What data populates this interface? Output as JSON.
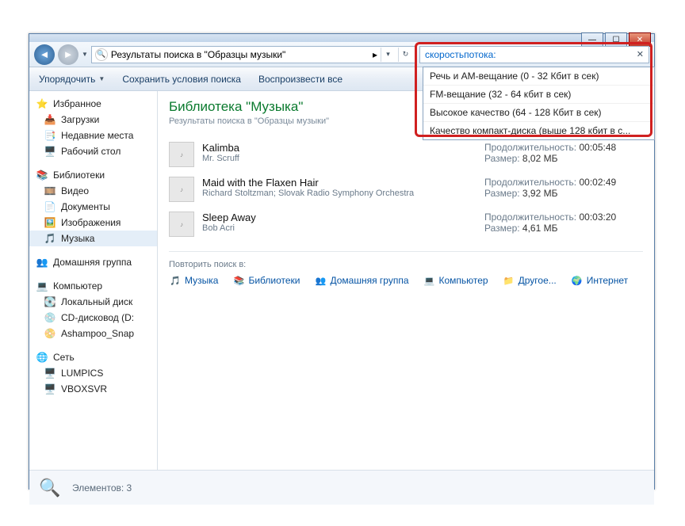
{
  "window": {
    "breadcrumb": "Результаты поиска в \"Образцы музыки\"",
    "search_value": "скоростьпотока:"
  },
  "toolbar": {
    "organize": "Упорядочить",
    "save_search": "Сохранить условия поиска",
    "play_all": "Воспроизвести все"
  },
  "sidebar": {
    "favorites": "Избранное",
    "downloads": "Загрузки",
    "recent": "Недавние места",
    "desktop": "Рабочий стол",
    "libraries": "Библиотеки",
    "videos": "Видео",
    "documents": "Документы",
    "pictures": "Изображения",
    "music": "Музыка",
    "homegroup": "Домашняя группа",
    "computer": "Компьютер",
    "local_disk": "Локальный диск",
    "cd_drive": "CD-дисковод (D:",
    "ashampoo": "Ashampoo_Snap",
    "network": "Сеть",
    "lumpics": "LUMPICS",
    "vboxsvr": "VBOXSVR"
  },
  "library": {
    "title": "Библиотека \"Музыка\"",
    "subtitle": "Результаты поиска в \"Образцы музыки\""
  },
  "results": [
    {
      "title": "Kalimba",
      "artist": "Mr. Scruff",
      "duration_label": "Продолжительность:",
      "duration": "00:05:48",
      "size_label": "Размер:",
      "size": "8,02 МБ"
    },
    {
      "title": "Maid with the Flaxen Hair",
      "artist": "Richard Stoltzman; Slovak Radio Symphony Orchestra",
      "duration_label": "Продолжительность:",
      "duration": "00:02:49",
      "size_label": "Размер:",
      "size": "3,92 МБ"
    },
    {
      "title": "Sleep Away",
      "artist": "Bob Acri",
      "duration_label": "Продолжительность:",
      "duration": "00:03:20",
      "size_label": "Размер:",
      "size": "4,61 МБ"
    }
  ],
  "repeat": {
    "label": "Повторить поиск в:",
    "music": "Музыка",
    "libraries": "Библиотеки",
    "homegroup": "Домашняя группа",
    "computer": "Компьютер",
    "other": "Другое...",
    "internet": "Интернет"
  },
  "suggestions": [
    "Речь и AM-вещание (0 - 32 Кбит в сек)",
    "FM-вещание (32 - 64 кбит в сек)",
    "Высокое качество (64 - 128 Кбит в сек)",
    "Качество компакт-диска (выше 128 кбит в с..."
  ],
  "status": {
    "elements": "Элементов: 3"
  }
}
